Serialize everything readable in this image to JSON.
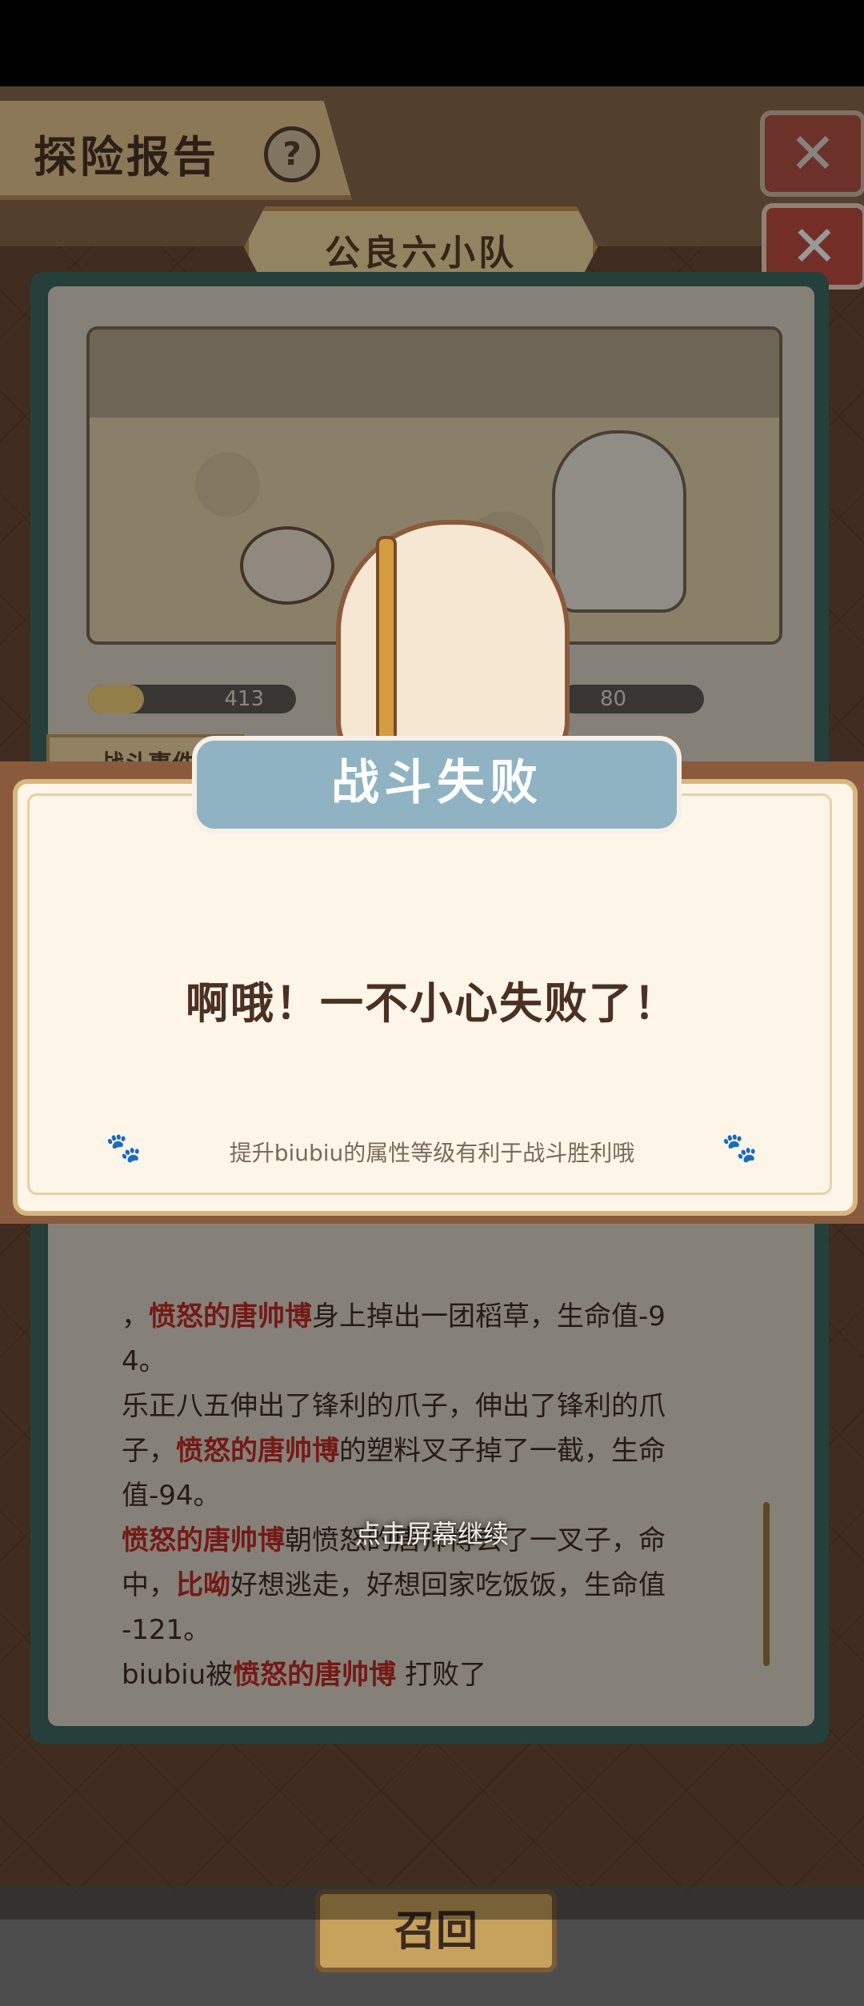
{
  "header": {
    "title": "探险报告",
    "help_icon": "?",
    "close_icon": "✕"
  },
  "team": {
    "name": "公良六小队"
  },
  "battle": {
    "player_hp": "413",
    "enemy_hp": "80"
  },
  "events": {
    "tag": "战斗事件",
    "lines_top": [
      {
        "prefix": "…，",
        "red": "比呦",
        "rest": ""
      }
    ],
    "lines_bottom": [
      {
        "prefix": "，",
        "red": "愤怒的唐帅博",
        "rest": "身上掉出一团稻草，生命值-9"
      },
      {
        "prefix": "",
        "red": "",
        "rest": "4。"
      },
      {
        "prefix": "乐正八五伸出了锋利的爪子，伸出了锋利的爪",
        "red": "",
        "rest": ""
      },
      {
        "prefix": "子，",
        "red": "愤怒的唐帅博",
        "rest": "的塑料叉子掉了一截，生命"
      },
      {
        "prefix": "值-94。",
        "red": "",
        "rest": ""
      },
      {
        "prefix": "",
        "red": "愤怒的唐帅博",
        "rest": "朝愤怒的唐帅博丢了一叉子，命"
      },
      {
        "prefix": "中，",
        "red": "比呦",
        "rest": "好想逃走，好想回家吃饭饭，生命值"
      },
      {
        "prefix": "-121。",
        "red": "",
        "rest": ""
      },
      {
        "prefix": "biubiu被",
        "red": "愤怒的唐帅博",
        "rest": " 打败了"
      }
    ]
  },
  "recall_button": "召回",
  "modal": {
    "banner": "战斗失败",
    "message": "啊哦！一不小心失败了！",
    "tip": "提升biubiu的属性等级有利于战斗胜利哦",
    "paw_icon": "🐾"
  },
  "continue_hint": "点击屏幕继续"
}
